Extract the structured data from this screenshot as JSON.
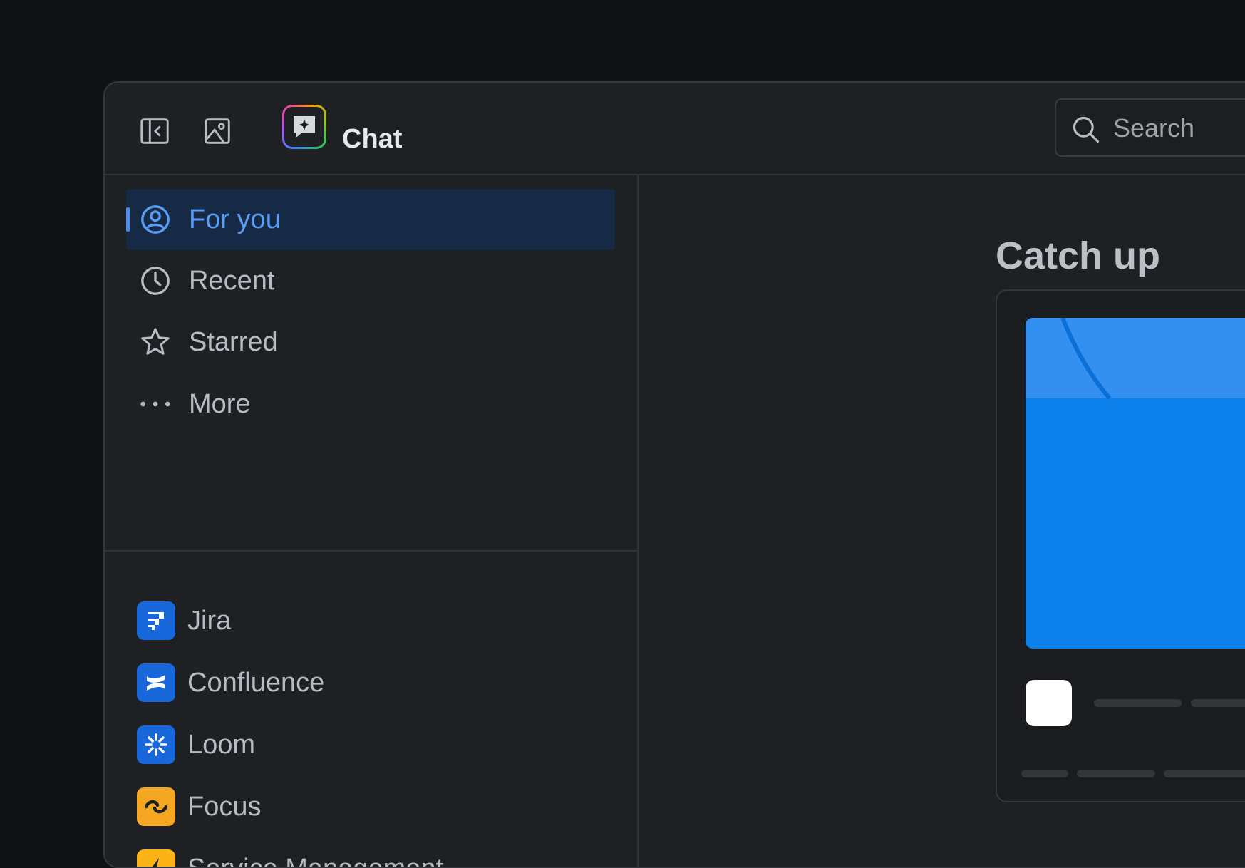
{
  "topbar": {
    "sidebar_toggle_icon": "sidebar-collapse-icon",
    "image_icon": "image-icon",
    "chat_icon": "chat-sparkle-icon",
    "chat_title": "Chat",
    "search_placeholder": "Search"
  },
  "sidebar": {
    "nav": [
      {
        "label": "For you",
        "icon": "person-circle-icon",
        "active": true
      },
      {
        "label": "Recent",
        "icon": "clock-icon"
      },
      {
        "label": "Starred",
        "icon": "star-icon"
      },
      {
        "label": "More",
        "icon": "more-dots-icon"
      }
    ],
    "apps": [
      {
        "label": "Jira",
        "icon": "jira-logo-icon",
        "color": "#1868db"
      },
      {
        "label": "Confluence",
        "icon": "confluence-logo-icon",
        "color": "#1868db"
      },
      {
        "label": "Loom",
        "icon": "loom-logo-icon",
        "color": "#1868db"
      },
      {
        "label": "Focus",
        "icon": "focus-logo-icon",
        "color": "#f5a623"
      },
      {
        "label": "Service Management",
        "icon": "service-management-logo-icon",
        "color": "#fcb316"
      }
    ]
  },
  "main": {
    "section_title": "Catch up"
  },
  "colors": {
    "background": "#101114",
    "window": "#1f2023",
    "active_nav_bg": "#172a45",
    "active_nav_text": "#5a9df5",
    "card_hero": "#0b80ea"
  }
}
